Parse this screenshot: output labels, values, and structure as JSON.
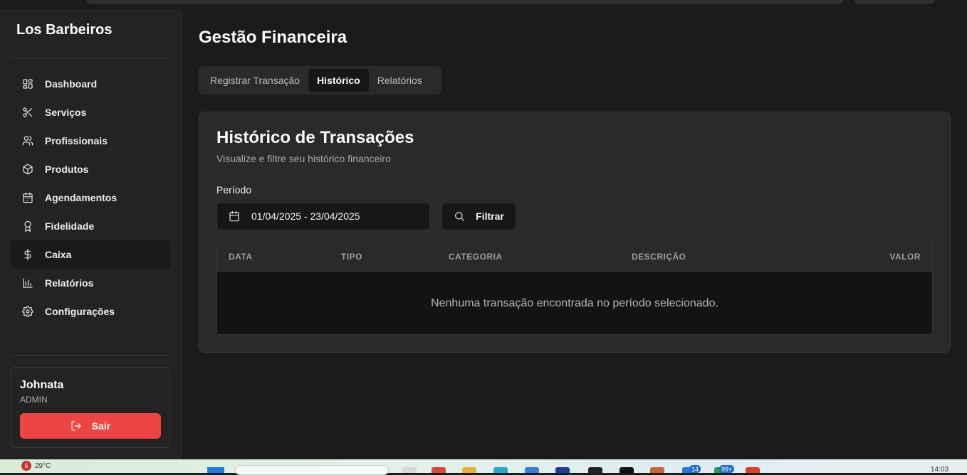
{
  "sidebar": {
    "brand": "Los Barbeiros",
    "items": [
      {
        "label": "Dashboard",
        "icon": "dashboard-icon"
      },
      {
        "label": "Serviços",
        "icon": "scissors-icon"
      },
      {
        "label": "Profissionais",
        "icon": "users-icon"
      },
      {
        "label": "Produtos",
        "icon": "package-icon"
      },
      {
        "label": "Agendamentos",
        "icon": "calendar-icon"
      },
      {
        "label": "Fidelidade",
        "icon": "award-icon"
      },
      {
        "label": "Caixa",
        "icon": "dollar-icon",
        "active": true
      },
      {
        "label": "Relatórios",
        "icon": "bar-chart-icon"
      },
      {
        "label": "Configurações",
        "icon": "gear-icon"
      }
    ],
    "user": {
      "name": "Johnata",
      "role": "ADMIN",
      "logout_label": "Sair"
    }
  },
  "main": {
    "title": "Gestão Financeira",
    "tabs": [
      {
        "label": "Registrar Transação"
      },
      {
        "label": "Histórico",
        "active": true
      },
      {
        "label": "Relatórios"
      }
    ],
    "card": {
      "title": "Histórico de Transações",
      "subtitle": "Visualize e filtre seu histórico financeiro",
      "period_label": "Período",
      "date_range": "01/04/2025 - 23/04/2025",
      "filter_label": "Filtrar",
      "table": {
        "columns": [
          "DATA",
          "TIPO",
          "CATEGORIA",
          "DESCRIÇÃO",
          "VALOR"
        ],
        "rows": [],
        "empty_message": "Nenhuma transação encontrada no período selecionado."
      }
    }
  },
  "taskbar": {
    "weather_badge": "6",
    "temperature": "29°C",
    "badge_mail": "14",
    "badge_other": "99+",
    "time": "14:03"
  },
  "colors": {
    "accent_logout": "#ef4444",
    "background": "#1b1b1b",
    "sidebar": "#232323",
    "card": "#2a2a2a"
  }
}
